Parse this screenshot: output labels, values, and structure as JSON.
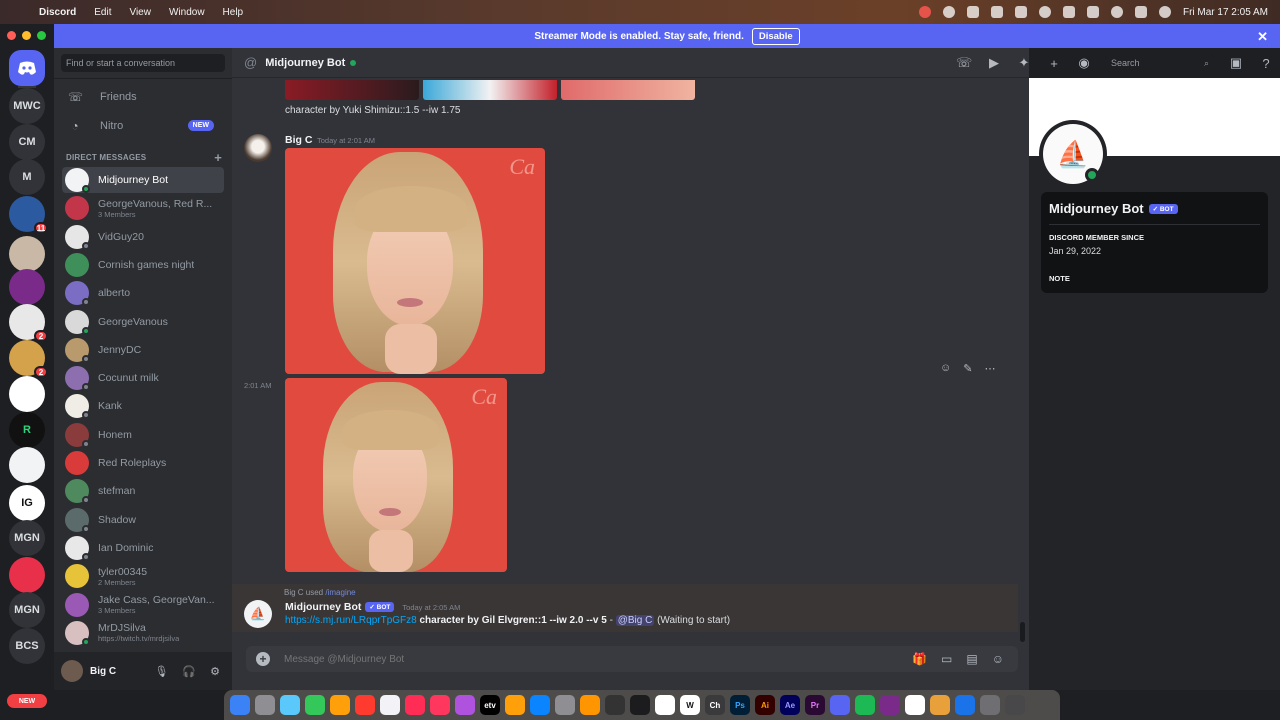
{
  "menubar": {
    "app": "Discord",
    "items": [
      "Edit",
      "View",
      "Window",
      "Help"
    ],
    "clock": "Fri Mar 17  2:05 AM"
  },
  "streamer": {
    "text": "Streamer Mode is enabled. Stay safe, friend.",
    "button": "Disable",
    "close": "✕"
  },
  "servers": {
    "items": [
      {
        "label": "MWC"
      },
      {
        "label": "CM"
      },
      {
        "label": "M"
      },
      {
        "label": "",
        "badge": "11"
      },
      {
        "label": ""
      },
      {
        "label": ""
      },
      {
        "label": "",
        "badge": "2"
      },
      {
        "label": "",
        "badge": "2"
      },
      {
        "label": ""
      },
      {
        "label": "R"
      },
      {
        "label": ""
      },
      {
        "label": "IG"
      },
      {
        "label": "MGN"
      },
      {
        "label": ""
      },
      {
        "label": "MGN"
      },
      {
        "label": "BCS"
      }
    ],
    "new_pill": "NEW"
  },
  "dm": {
    "search_placeholder": "Find or start a conversation",
    "nav": [
      {
        "label": "Friends",
        "icon": "friends-icon"
      },
      {
        "label": "Nitro",
        "icon": "nitro-icon",
        "badge": "NEW"
      }
    ],
    "header": "DIRECT MESSAGES",
    "header_plus": "+",
    "items": [
      {
        "name": "Midjourney Bot",
        "sub": "",
        "color": "#f2f3f5",
        "status": "#23a55a"
      },
      {
        "name": "GeorgeVanous, Red R...",
        "sub": "3 Members",
        "color": "#c3364a",
        "status": ""
      },
      {
        "name": "VidGuy20",
        "sub": "",
        "color": "#e6e6e6",
        "status": "#80848e"
      },
      {
        "name": "Cornish games night",
        "sub": "",
        "color": "#3f8f5a",
        "status": ""
      },
      {
        "name": "alberto",
        "sub": "",
        "color": "#7b6cc4",
        "status": "#80848e"
      },
      {
        "name": "GeorgeVanous",
        "sub": "",
        "color": "#d9d9d9",
        "status": "#23a55a"
      },
      {
        "name": "JennyDC",
        "sub": "",
        "color": "#b89a6c",
        "status": "#80848e"
      },
      {
        "name": "Cocunut milk",
        "sub": "",
        "color": "#8d6fb0",
        "status": "#80848e"
      },
      {
        "name": "Kank",
        "sub": "",
        "color": "#f0ece6",
        "status": "#80848e"
      },
      {
        "name": "Honem",
        "sub": "",
        "color": "#8a3b3b",
        "status": "#80848e"
      },
      {
        "name": "Red Roleplays",
        "sub": "",
        "color": "#d93a3a",
        "status": ""
      },
      {
        "name": "stefman",
        "sub": "",
        "color": "#4e8a5e",
        "status": "#80848e"
      },
      {
        "name": "Shadow",
        "sub": "",
        "color": "#5b6b6b",
        "status": "#80848e"
      },
      {
        "name": "Ian Dominic",
        "sub": "",
        "color": "#e8e8e8",
        "status": "#80848e"
      },
      {
        "name": "tyler00345",
        "sub": "2 Members",
        "color": "#e7c33a",
        "status": ""
      },
      {
        "name": "Jake Cass, GeorgeVan...",
        "sub": "3 Members",
        "color": "#9b59b6",
        "status": ""
      },
      {
        "name": "MrDJSilva",
        "sub": "https://twitch.tv/mrdjsilva",
        "color": "#d8c0c0",
        "status": "#23a55a"
      }
    ]
  },
  "user": {
    "name": "Big C"
  },
  "chat": {
    "channel": "Midjourney Bot",
    "search_placeholder": "Search",
    "prev_text": "character by Yuki Shimizu::1.5 --iw 1.75",
    "msg1": {
      "author": "Big C",
      "time": "Today at 2:01 AM"
    },
    "msg2_time": "2:01 AM",
    "bot_msg": {
      "used_by": "Big C used",
      "command": "/imagine",
      "author": "Midjourney Bot",
      "tag": "✓ BOT",
      "time": "Today at 2:05 AM",
      "link": "https://s.mj.run/LRqprTpGFz8",
      "prompt": "character by Gil Elvgren::1 --iw 2.0 --v 5",
      "dash": " - ",
      "mention": "@Big C",
      "status": "(Waiting to start)"
    },
    "composer_placeholder": "Message @Midjourney Bot"
  },
  "profile": {
    "name": "Midjourney Bot",
    "tag": "✓ BOT",
    "member_since_label": "DISCORD MEMBER SINCE",
    "member_since": "Jan 29, 2022",
    "note_label": "NOTE"
  },
  "dock": {
    "apps": [
      "",
      "",
      "",
      "",
      "",
      "",
      "",
      "",
      "",
      "",
      "etv",
      "",
      "",
      "",
      "",
      "",
      "",
      "",
      "W",
      "Ch",
      "Ps",
      "Ai",
      "Ae",
      "Pr",
      "",
      "",
      "",
      "",
      "",
      "",
      "",
      ""
    ]
  }
}
